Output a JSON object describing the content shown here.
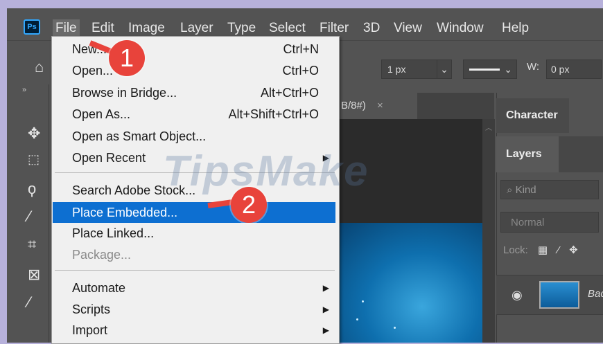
{
  "menubar": {
    "logo": "Ps",
    "items": [
      "File",
      "Edit",
      "Image",
      "Layer",
      "Type",
      "Select",
      "Filter",
      "3D",
      "View",
      "Window",
      "Help"
    ]
  },
  "optionsbar": {
    "stroke_width": "1 px",
    "w_label": "W:",
    "w_value": "0 px"
  },
  "document": {
    "tab_label": "B/8#)",
    "tab_close": "×"
  },
  "panels": {
    "character_tab": "Character",
    "layers_tab": "Layers",
    "kind_placeholder": "Kind",
    "blend_mode": "Normal",
    "lock_label": "Lock:",
    "layer_name": "Bac"
  },
  "file_menu": {
    "items": [
      {
        "label": "New...",
        "shortcut": "Ctrl+N"
      },
      {
        "label": "Open...",
        "shortcut": "Ctrl+O"
      },
      {
        "label": "Browse in Bridge...",
        "shortcut": "Alt+Ctrl+O"
      },
      {
        "label": "Open As...",
        "shortcut": "Alt+Shift+Ctrl+O"
      },
      {
        "label": "Open as Smart Object...",
        "shortcut": ""
      },
      {
        "label": "Open Recent",
        "shortcut": ""
      },
      {
        "label": "Search Adobe Stock...",
        "shortcut": ""
      },
      {
        "label": "Place Embedded...",
        "shortcut": ""
      },
      {
        "label": "Place Linked...",
        "shortcut": ""
      },
      {
        "label": "Package...",
        "shortcut": ""
      },
      {
        "label": "Automate",
        "shortcut": ""
      },
      {
        "label": "Scripts",
        "shortcut": ""
      },
      {
        "label": "Import",
        "shortcut": ""
      }
    ]
  },
  "callouts": {
    "one": "1",
    "two": "2"
  },
  "watermark": "TipsMake",
  "colors": {
    "highlight": "#0d6fd1",
    "callout": "#e8433b"
  }
}
